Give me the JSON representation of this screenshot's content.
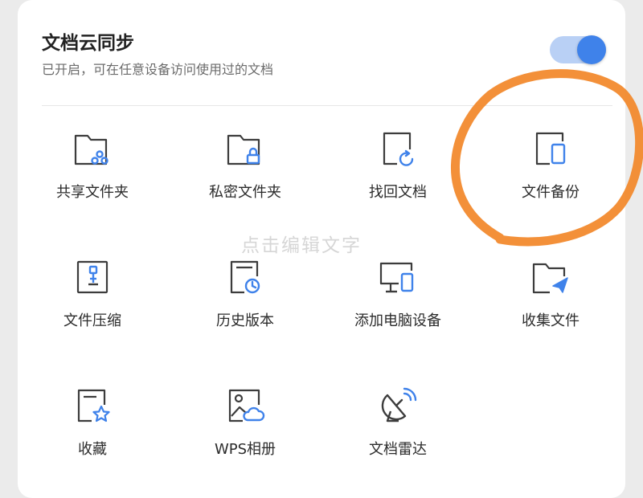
{
  "sync": {
    "title": "文档云同步",
    "subtitle": "已开启，可在任意设备访问使用过的文档",
    "toggle_on": true
  },
  "tools": [
    {
      "label": "共享文件夹",
      "icon": "shared-folder-icon"
    },
    {
      "label": "私密文件夹",
      "icon": "private-folder-icon"
    },
    {
      "label": "找回文档",
      "icon": "recover-document-icon"
    },
    {
      "label": "文件备份",
      "icon": "file-backup-icon"
    },
    {
      "label": "文件压缩",
      "icon": "file-compress-icon"
    },
    {
      "label": "历史版本",
      "icon": "history-version-icon"
    },
    {
      "label": "添加电脑设备",
      "icon": "add-computer-device-icon"
    },
    {
      "label": "收集文件",
      "icon": "collect-files-icon"
    },
    {
      "label": "收藏",
      "icon": "favorites-icon"
    },
    {
      "label": "WPS相册",
      "icon": "wps-album-icon"
    },
    {
      "label": "文档雷达",
      "icon": "document-radar-icon"
    }
  ],
  "watermark": "点击编辑文字",
  "colors": {
    "accent": "#3f82ea",
    "toggle_track": "#b9d0f5",
    "annotation_stroke": "#f28a2e",
    "icon_stroke": "#3c3c3c"
  }
}
